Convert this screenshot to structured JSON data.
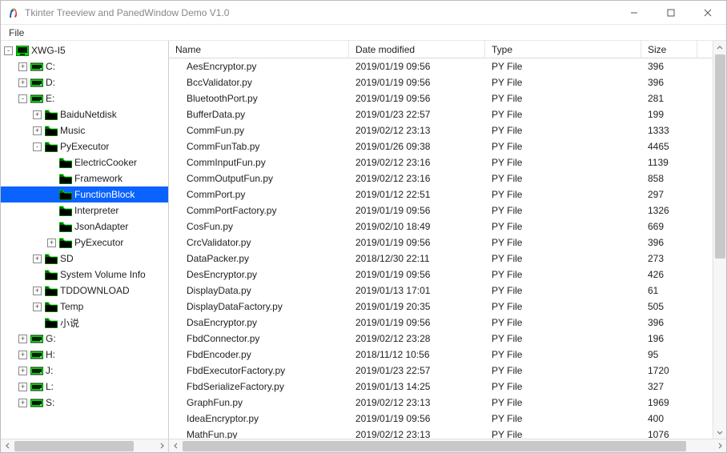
{
  "window": {
    "title": "Tkinter Treeview and PanedWindow Demo V1.0"
  },
  "menu": {
    "file": "File"
  },
  "tree": [
    {
      "depth": 0,
      "expand": "-",
      "icon": "computer",
      "label": "XWG-I5"
    },
    {
      "depth": 1,
      "expand": "+",
      "icon": "drive",
      "label": "C:"
    },
    {
      "depth": 1,
      "expand": "+",
      "icon": "drive",
      "label": "D:"
    },
    {
      "depth": 1,
      "expand": "-",
      "icon": "drive",
      "label": "E:"
    },
    {
      "depth": 2,
      "expand": "+",
      "icon": "folder",
      "label": "BaiduNetdisk"
    },
    {
      "depth": 2,
      "expand": "+",
      "icon": "folder",
      "label": "Music"
    },
    {
      "depth": 2,
      "expand": "-",
      "icon": "folder",
      "label": "PyExecutor"
    },
    {
      "depth": 3,
      "expand": " ",
      "icon": "folder",
      "label": "ElectricCooker"
    },
    {
      "depth": 3,
      "expand": " ",
      "icon": "folder",
      "label": "Framework"
    },
    {
      "depth": 3,
      "expand": " ",
      "icon": "folder",
      "label": "FunctionBlock",
      "selected": true
    },
    {
      "depth": 3,
      "expand": " ",
      "icon": "folder",
      "label": "Interpreter"
    },
    {
      "depth": 3,
      "expand": " ",
      "icon": "folder",
      "label": "JsonAdapter"
    },
    {
      "depth": 3,
      "expand": "+",
      "icon": "folder",
      "label": "PyExecutor"
    },
    {
      "depth": 2,
      "expand": "+",
      "icon": "folder",
      "label": "SD"
    },
    {
      "depth": 2,
      "expand": " ",
      "icon": "folder",
      "label": "System Volume Info"
    },
    {
      "depth": 2,
      "expand": "+",
      "icon": "folder",
      "label": "TDDOWNLOAD"
    },
    {
      "depth": 2,
      "expand": "+",
      "icon": "folder",
      "label": "Temp"
    },
    {
      "depth": 2,
      "expand": " ",
      "icon": "folder",
      "label": "小说"
    },
    {
      "depth": 1,
      "expand": "+",
      "icon": "drive",
      "label": "G:"
    },
    {
      "depth": 1,
      "expand": "+",
      "icon": "drive",
      "label": "H:"
    },
    {
      "depth": 1,
      "expand": "+",
      "icon": "drive",
      "label": "J:"
    },
    {
      "depth": 1,
      "expand": "+",
      "icon": "drive",
      "label": "L:"
    },
    {
      "depth": 1,
      "expand": "+",
      "icon": "drive",
      "label": "S:"
    }
  ],
  "table": {
    "columns": {
      "name": "Name",
      "date": "Date modified",
      "type": "Type",
      "size": "Size"
    },
    "rows": [
      {
        "name": "AesEncryptor.py",
        "date": "2019/01/19 09:56",
        "type": "PY File",
        "size": "396"
      },
      {
        "name": "BccValidator.py",
        "date": "2019/01/19 09:56",
        "type": "PY File",
        "size": "396"
      },
      {
        "name": "BluetoothPort.py",
        "date": "2019/01/19 09:56",
        "type": "PY File",
        "size": "281"
      },
      {
        "name": "BufferData.py",
        "date": "2019/01/23 22:57",
        "type": "PY File",
        "size": "199"
      },
      {
        "name": "CommFun.py",
        "date": "2019/02/12 23:13",
        "type": "PY File",
        "size": "1333"
      },
      {
        "name": "CommFunTab.py",
        "date": "2019/01/26 09:38",
        "type": "PY File",
        "size": "4465"
      },
      {
        "name": "CommInputFun.py",
        "date": "2019/02/12 23:16",
        "type": "PY File",
        "size": "1139"
      },
      {
        "name": "CommOutputFun.py",
        "date": "2019/02/12 23:16",
        "type": "PY File",
        "size": "858"
      },
      {
        "name": "CommPort.py",
        "date": "2019/01/12 22:51",
        "type": "PY File",
        "size": "297"
      },
      {
        "name": "CommPortFactory.py",
        "date": "2019/01/19 09:56",
        "type": "PY File",
        "size": "1326"
      },
      {
        "name": "CosFun.py",
        "date": "2019/02/10 18:49",
        "type": "PY File",
        "size": "669"
      },
      {
        "name": "CrcValidator.py",
        "date": "2019/01/19 09:56",
        "type": "PY File",
        "size": "396"
      },
      {
        "name": "DataPacker.py",
        "date": "2018/12/30 22:11",
        "type": "PY File",
        "size": "273"
      },
      {
        "name": "DesEncryptor.py",
        "date": "2019/01/19 09:56",
        "type": "PY File",
        "size": "426"
      },
      {
        "name": "DisplayData.py",
        "date": "2019/01/13 17:01",
        "type": "PY File",
        "size": "61"
      },
      {
        "name": "DisplayDataFactory.py",
        "date": "2019/01/19 20:35",
        "type": "PY File",
        "size": "505"
      },
      {
        "name": "DsaEncryptor.py",
        "date": "2019/01/19 09:56",
        "type": "PY File",
        "size": "396"
      },
      {
        "name": "FbdConnector.py",
        "date": "2019/02/12 23:28",
        "type": "PY File",
        "size": "196"
      },
      {
        "name": "FbdEncoder.py",
        "date": "2018/11/12 10:56",
        "type": "PY File",
        "size": "95"
      },
      {
        "name": "FbdExecutorFactory.py",
        "date": "2019/01/23 22:57",
        "type": "PY File",
        "size": "1720"
      },
      {
        "name": "FbdSerializeFactory.py",
        "date": "2019/01/13 14:25",
        "type": "PY File",
        "size": "327"
      },
      {
        "name": "GraphFun.py",
        "date": "2019/02/12 23:13",
        "type": "PY File",
        "size": "1969"
      },
      {
        "name": "IdeaEncryptor.py",
        "date": "2019/01/19 09:56",
        "type": "PY File",
        "size": "400"
      },
      {
        "name": "MathFun.py",
        "date": "2019/02/12 23:13",
        "type": "PY File",
        "size": "1076"
      }
    ]
  }
}
